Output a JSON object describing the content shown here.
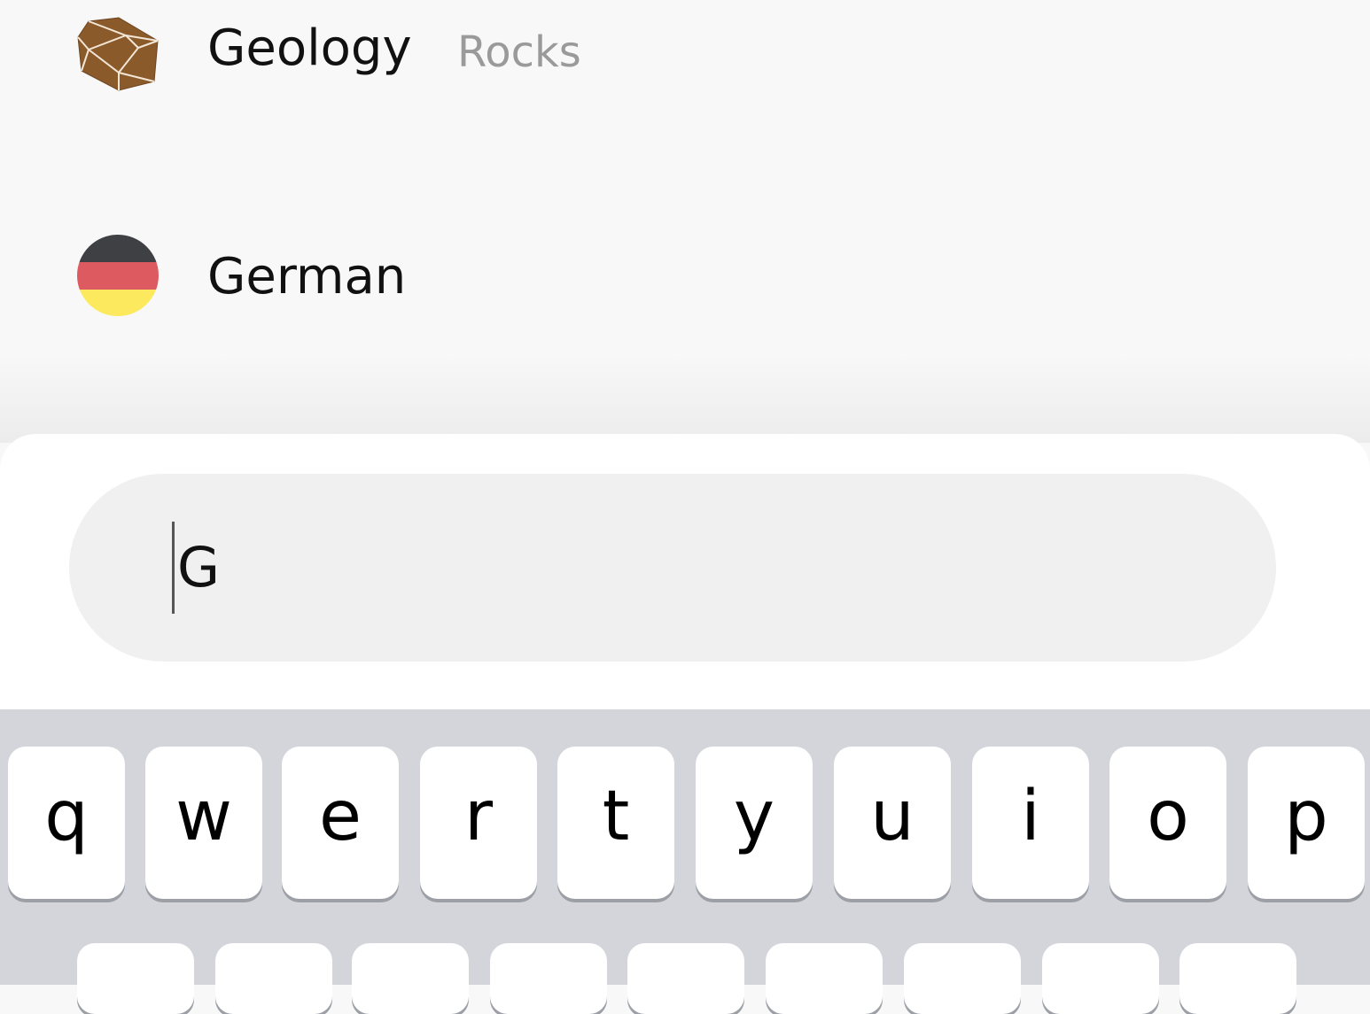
{
  "results": [
    {
      "title": "Geology",
      "subtitle": "Rocks",
      "icon": "rock-icon"
    },
    {
      "title": "German",
      "subtitle": "",
      "icon": "german-flag-icon"
    }
  ],
  "search": {
    "value": "G"
  },
  "keyboard": {
    "row1": [
      "q",
      "w",
      "e",
      "r",
      "t",
      "y",
      "u",
      "i",
      "o",
      "p"
    ]
  },
  "colors": {
    "rock": "#8a5a2b",
    "flag_black": "#3f4044",
    "flag_red": "#dc5a60",
    "flag_gold": "#fde95e"
  }
}
